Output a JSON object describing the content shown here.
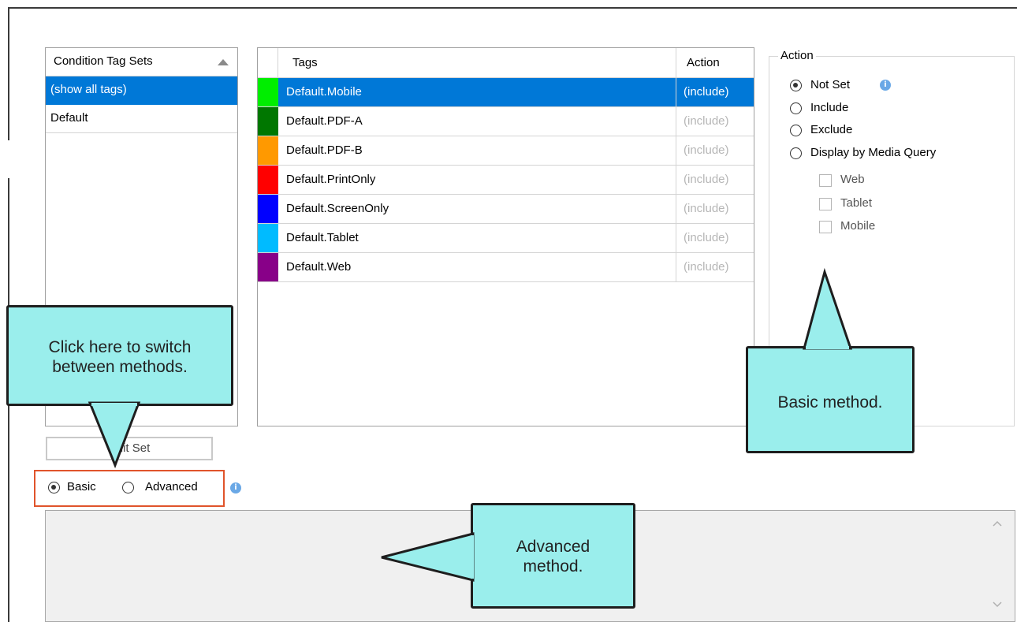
{
  "condition_tag_sets": {
    "header": "Condition Tag Sets",
    "items": [
      {
        "label": "(show all tags)",
        "selected": true
      },
      {
        "label": "Default",
        "selected": false
      }
    ]
  },
  "tags_grid": {
    "col_tags": "Tags",
    "col_action": "Action",
    "rows": [
      {
        "name": "Default.Mobile",
        "color": "#00ee00",
        "action": "(include)",
        "selected": true
      },
      {
        "name": "Default.PDF-A",
        "color": "#007700",
        "action": "(include)",
        "selected": false
      },
      {
        "name": "Default.PDF-B",
        "color": "#ff9900",
        "action": "(include)",
        "selected": false
      },
      {
        "name": "Default.PrintOnly",
        "color": "#ff0000",
        "action": "(include)",
        "selected": false
      },
      {
        "name": "Default.ScreenOnly",
        "color": "#0000ff",
        "action": "(include)",
        "selected": false
      },
      {
        "name": "Default.Tablet",
        "color": "#00bbff",
        "action": "(include)",
        "selected": false
      },
      {
        "name": "Default.Web",
        "color": "#880088",
        "action": "(include)",
        "selected": false
      }
    ]
  },
  "action_group": {
    "legend": "Action",
    "options": [
      {
        "label": "Not Set",
        "checked": true
      },
      {
        "label": "Include",
        "checked": false
      },
      {
        "label": "Exclude",
        "checked": false
      },
      {
        "label": "Display by Media Query",
        "checked": false
      }
    ],
    "media": [
      "Web",
      "Tablet",
      "Mobile"
    ],
    "info_icon": "info-icon"
  },
  "edit_set_button": "Edit Set",
  "mode": {
    "basic": "Basic",
    "advanced": "Advanced",
    "selected": "basic",
    "info_icon": "info-icon"
  },
  "callouts": {
    "switch_line1": "Click here to switch",
    "switch_line2": "between methods.",
    "basic": "Basic method.",
    "advanced_line1": "Advanced",
    "advanced_line2": "method."
  },
  "colors": {
    "selection": "#0078d7",
    "callout_fill": "#9aeeec",
    "highlight_border": "#e0542b"
  }
}
